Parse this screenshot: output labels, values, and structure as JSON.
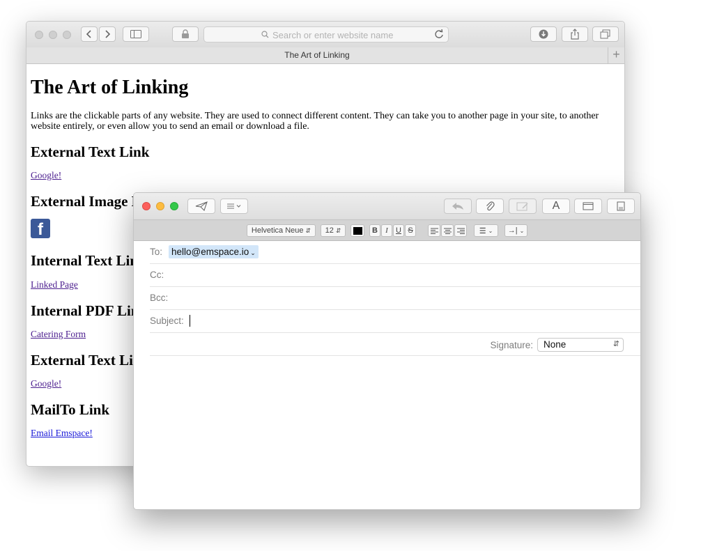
{
  "safari": {
    "address_placeholder": "Search or enter website name",
    "tab_title": "The Art of Linking",
    "new_tab": "+",
    "page": {
      "heading": "The Art of Linking",
      "intro": "Links are the clickable parts of any website. They are used to connect different content. They can take you to another page in your site, to another website entirely, or even allow you to send an email or download a file.",
      "sections": [
        {
          "heading": "External Text Link",
          "link": "Google!"
        },
        {
          "heading": "External Image Link",
          "link": "f"
        },
        {
          "heading": "Internal Text Link",
          "link": "Linked Page"
        },
        {
          "heading": "Internal PDF Link",
          "link": "Catering Form"
        },
        {
          "heading": "External Text Link",
          "link": "Google!"
        },
        {
          "heading": "MailTo Link",
          "link": "Email Emspace!"
        }
      ]
    }
  },
  "mail": {
    "format": {
      "font": "Helvetica Neue",
      "size": "12",
      "bold": "B",
      "italic": "I",
      "underline": "U",
      "strike": "S",
      "list": "☰",
      "indent": "→|"
    },
    "fields": {
      "to_label": "To:",
      "to_value": "hello@emspace.io",
      "cc_label": "Cc:",
      "bcc_label": "Bcc:",
      "subject_label": "Subject:",
      "signature_label": "Signature:",
      "signature_value": "None"
    },
    "colors": {
      "close": "#fc605c",
      "minimize": "#fdbc40",
      "zoom": "#34c84a",
      "token": "#d2e6f9",
      "facebook": "#3b5998"
    }
  }
}
